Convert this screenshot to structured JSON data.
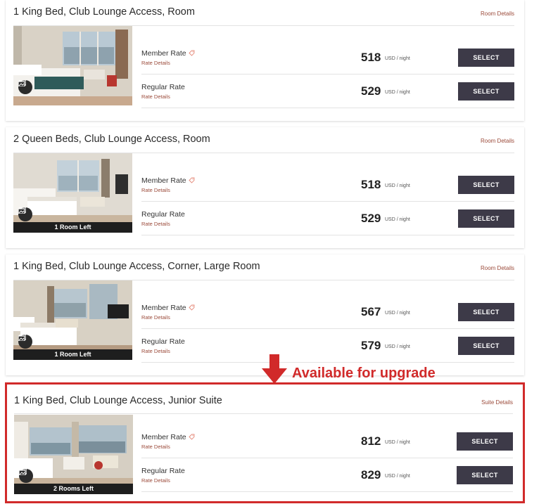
{
  "rooms": [
    {
      "title": "1 King Bed, Club Lounge Access, Room",
      "details_link": "Room Details",
      "rooms_left": "",
      "rates": [
        {
          "name": "Member Rate",
          "details": "Rate Details",
          "price": "518",
          "unit": "USD / night",
          "button": "SELECT",
          "member": true
        },
        {
          "name": "Regular Rate",
          "details": "Rate Details",
          "price": "529",
          "unit": "USD / night",
          "button": "SELECT",
          "member": false
        }
      ]
    },
    {
      "title": "2 Queen Beds, Club Lounge Access, Room",
      "details_link": "Room Details",
      "rooms_left": "1 Room Left",
      "rates": [
        {
          "name": "Member Rate",
          "details": "Rate Details",
          "price": "518",
          "unit": "USD / night",
          "button": "SELECT",
          "member": true
        },
        {
          "name": "Regular Rate",
          "details": "Rate Details",
          "price": "529",
          "unit": "USD / night",
          "button": "SELECT",
          "member": false
        }
      ]
    },
    {
      "title": "1 King Bed, Club Lounge Access, Corner, Large Room",
      "details_link": "Room Details",
      "rooms_left": "1 Room Left",
      "rates": [
        {
          "name": "Member Rate",
          "details": "Rate Details",
          "price": "567",
          "unit": "USD / night",
          "button": "SELECT",
          "member": true
        },
        {
          "name": "Regular Rate",
          "details": "Rate Details",
          "price": "579",
          "unit": "USD / night",
          "button": "SELECT",
          "member": false
        }
      ]
    },
    {
      "title": "1 King Bed, Club Lounge Access, Junior Suite",
      "details_link": "Suite Details",
      "rooms_left": "2 Rooms Left",
      "rates": [
        {
          "name": "Member Rate",
          "details": "Rate Details",
          "price": "812",
          "unit": "USD / night",
          "button": "SELECT",
          "member": true
        },
        {
          "name": "Regular Rate",
          "details": "Rate Details",
          "price": "829",
          "unit": "USD / night",
          "button": "SELECT",
          "member": false
        }
      ]
    }
  ],
  "annotation": {
    "text": "Available for upgrade",
    "color": "#d12a2a",
    "icon": "arrow-down-icon"
  },
  "colors": {
    "select_button": "#3d3a48",
    "link": "#9b4a3a",
    "highlight_border": "#d12a2a"
  }
}
